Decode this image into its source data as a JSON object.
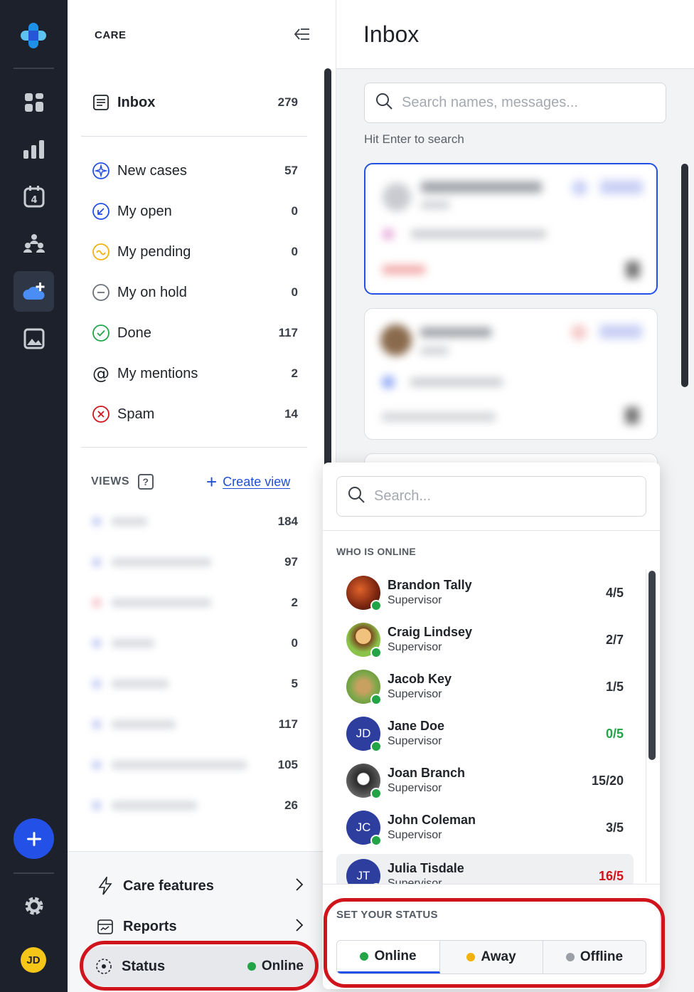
{
  "sidebar": {
    "title": "CARE",
    "inbox": {
      "label": "Inbox",
      "count": "279"
    },
    "folders": [
      {
        "label": "New cases",
        "count": "57",
        "icon": "sparkle-circle-icon"
      },
      {
        "label": "My open",
        "count": "0",
        "icon": "arrow-circle-icon"
      },
      {
        "label": "My pending",
        "count": "0",
        "icon": "wave-circle-icon"
      },
      {
        "label": "My on hold",
        "count": "0",
        "icon": "minus-circle-icon"
      },
      {
        "label": "Done",
        "count": "117",
        "icon": "check-circle-icon"
      },
      {
        "label": "My mentions",
        "count": "2",
        "icon": "at-icon"
      },
      {
        "label": "Spam",
        "count": "14",
        "icon": "x-circle-icon"
      }
    ],
    "views_label": "VIEWS",
    "views_help": "?",
    "create_view_label": "Create view",
    "views": [
      {
        "count": "184"
      },
      {
        "count": "97"
      },
      {
        "count": "2"
      },
      {
        "count": "0"
      },
      {
        "count": "5"
      },
      {
        "count": "117"
      },
      {
        "count": "105"
      },
      {
        "count": "26"
      }
    ],
    "care_features_label": "Care features",
    "reports_label": "Reports",
    "status_label": "Status",
    "status_value": "Online"
  },
  "rail": {
    "avatar_initials": "JD"
  },
  "main": {
    "title": "Inbox",
    "search_placeholder": "Search names, messages...",
    "search_hint": "Hit Enter to search"
  },
  "popover": {
    "search_placeholder": "Search...",
    "who_online_label": "WHO IS ONLINE",
    "agents": [
      {
        "name": "Brandon Tally",
        "role": "Supervisor",
        "ratio": "4/5"
      },
      {
        "name": "Craig Lindsey",
        "role": "Supervisor",
        "ratio": "2/7"
      },
      {
        "name": "Jacob Key",
        "role": "Supervisor",
        "ratio": "1/5"
      },
      {
        "name": "Jane Doe",
        "role": "Supervisor",
        "ratio": "0/5",
        "initials": "JD"
      },
      {
        "name": "Joan Branch",
        "role": "Supervisor",
        "ratio": "15/20"
      },
      {
        "name": "John Coleman",
        "role": "Supervisor",
        "ratio": "3/5",
        "initials": "JC"
      },
      {
        "name": "Julia Tisdale",
        "role": "Supervisor",
        "ratio": "16/5",
        "initials": "JT"
      }
    ],
    "set_status_label": "SET YOUR STATUS",
    "status_options": [
      {
        "label": "Online",
        "color": "#22a447"
      },
      {
        "label": "Away",
        "color": "#f2b10e"
      },
      {
        "label": "Offline",
        "color": "#9aa0a6"
      }
    ]
  },
  "colors": {
    "accent": "#2350e6",
    "highlight_ring": "#d0141c",
    "online": "#22a447"
  }
}
